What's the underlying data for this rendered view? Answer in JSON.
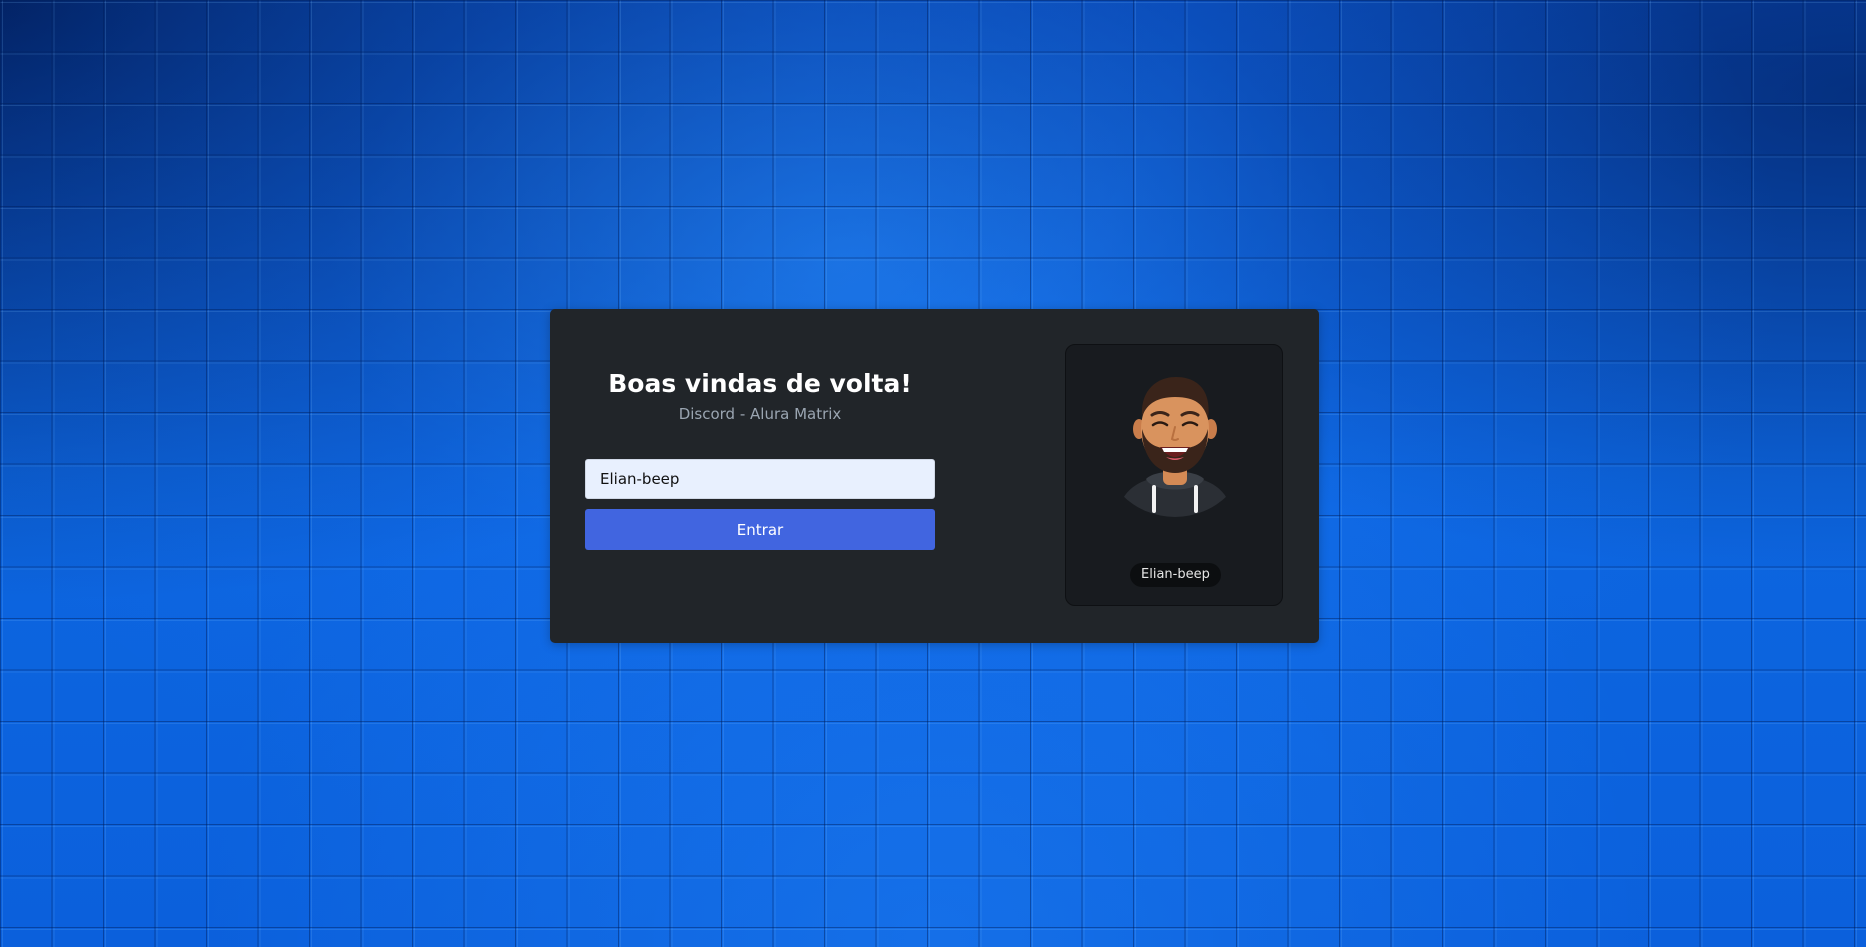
{
  "login": {
    "title": "Boas vindas de volta!",
    "subtitle": "Discord - Alura Matrix",
    "username_value": "Elian-beep",
    "submit_label": "Entrar"
  },
  "profile": {
    "avatar_icon": "avatar-icon",
    "username": "Elian-beep"
  },
  "colors": {
    "card_background": "#212529",
    "button": "#4165e0",
    "background": "#0b5ad6"
  }
}
